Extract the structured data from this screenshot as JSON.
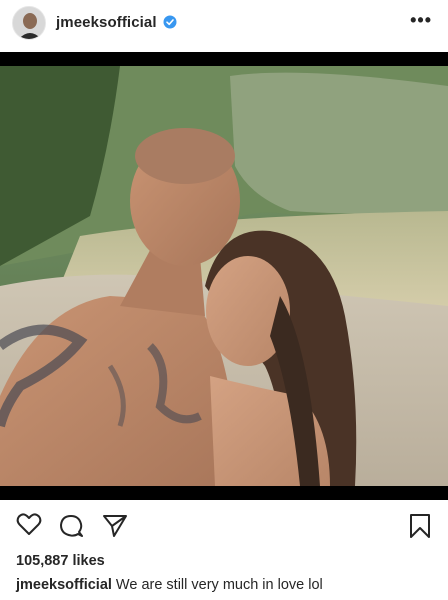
{
  "post": {
    "username": "jmeeksofficial",
    "verified": true,
    "more_icon": "more-horizontal-icon",
    "likes": "105,887 likes",
    "caption_user": "jmeeksofficial",
    "caption_text": "We are still very much in love  lol"
  },
  "actions": {
    "icons": [
      "heart-icon",
      "comment-icon",
      "share-icon",
      "bookmark-icon"
    ]
  },
  "colors": {
    "verified_blue": "#3897f0",
    "text": "#262626",
    "photo_border": "#000000"
  }
}
